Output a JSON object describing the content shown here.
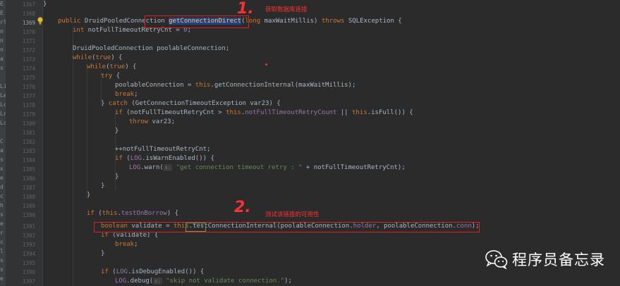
{
  "left_strip": [
    "E",
    "E",
    "rl",
    "n",
    "n",
    "n",
    "a",
    "s",
    "",
    "Li",
    "Le",
    "Lc",
    "Lr",
    "Lc",
    "",
    "C",
    "a",
    "s",
    "x",
    "e",
    "d",
    "c",
    "h",
    "s",
    "e",
    "r",
    "c",
    "l",
    "s",
    "s",
    "e"
  ],
  "line_numbers": [
    "1367",
    "1368",
    "1369",
    "1370",
    "1371",
    "1372",
    "1373",
    "1374",
    "1375",
    "1376",
    "1377",
    "1378",
    "1379",
    "1380",
    "1381",
    "1382",
    "1383",
    "1384",
    "1385",
    "1386",
    "1387",
    "1388",
    "1389",
    "1390",
    "1391",
    "1392",
    "1393",
    "1394",
    "1395",
    "1396",
    "1397"
  ],
  "code": {
    "l1367": "}",
    "l1369_kw1": "public",
    "l1369_type": " DruidPooledConnection ",
    "l1369_fn": "getConnectionDirect",
    "l1369_p1": "(",
    "l1369_kw2": "long",
    "l1369_p2": " maxWaitMillis) ",
    "l1369_kw3": "throws",
    "l1369_p3": " SQLException {",
    "l1370_kw": "int",
    "l1370_rest": " notFullTimeoutRetryCnt = ",
    "l1370_num": "0",
    "l1370_end": ";",
    "l1372": "DruidPooledConnection poolableConnection;",
    "l1373_kw": "while",
    "l1373_p": "(",
    "l1373_kw2": "true",
    "l1373_end": ") {",
    "l1374_kw": "while",
    "l1374_p": "(",
    "l1374_kw2": "true",
    "l1374_end": ") {",
    "l1375_kw": "try",
    "l1375_end": " {",
    "l1376_a": "poolableConnection = ",
    "l1376_kw": "this",
    "l1376_b": ".getConnectionInternal(maxWaitMillis);",
    "l1377_kw": "break",
    "l1377_end": ";",
    "l1378_a": "} ",
    "l1378_kw": "catch",
    "l1378_b": " (GetConnectionTimeoutException var23) {",
    "l1379_kw": "if",
    "l1379_a": " (notFullTimeoutRetryCnt > ",
    "l1379_kw2": "this",
    "l1379_b": ".",
    "l1379_mb": "notFullTimeoutRetryCount",
    "l1379_c": " || ",
    "l1379_kw3": "this",
    "l1379_d": ".isFull()) {",
    "l1380_kw": "throw",
    "l1380_rest": " var23;",
    "l1381": "}",
    "l1383": "++notFullTimeoutRetryCnt;",
    "l1384_kw": "if",
    "l1384_a": " (",
    "l1384_mb": "LOG",
    "l1384_b": ".isWarnEnabled()) {",
    "l1385_mb": "LOG",
    "l1385_a": ".warn(",
    "l1385_hint": "s:",
    "l1385_st": "\"get connection timeout retry : \"",
    "l1385_b": " + notFullTimeoutRetryCnt);",
    "l1386": "}",
    "l1387": "}",
    "l1388": "}",
    "l1390_kw": "if",
    "l1390_a": " (",
    "l1390_kw2": "this",
    "l1390_b": ".",
    "l1390_mb": "testOnBorrow",
    "l1390_c": ") {",
    "l1391_kw": "boolean",
    "l1391_a": " validate = ",
    "l1391_kw2": "this",
    "l1391_b": ".",
    "l1391_hl": "test",
    "l1391_c": "ConnectionInternal(poolableConnection.",
    "l1391_mb": "holder",
    "l1391_d": ", poolableConnection.",
    "l1391_mb2": "conn",
    "l1391_e": ");",
    "l1392_kw": "if",
    "l1392_rest": " (validate) {",
    "l1393_kw": "break",
    "l1393_end": ";",
    "l1394": "}",
    "l1396_kw": "if",
    "l1396_a": " (",
    "l1396_mb": "LOG",
    "l1396_b": ".isDebugEnabled()) {",
    "l1397_mb": "LOG",
    "l1397_a": ".debug(",
    "l1397_hint": "s:",
    "l1397_st": "\"skip not validate connection.\"",
    "l1397_b": ");"
  },
  "annotations": {
    "num1": "1.",
    "label1": "获取数据库连接",
    "num2": "2.",
    "label2": "测试该链接的可用性"
  },
  "watermark": {
    "text": "程序员备忘录",
    "icon": "wechat-icon"
  },
  "colors": {
    "annotation_red": "#ff3030",
    "keyword": "#cc7832",
    "method_decl": "#ffc66d",
    "field": "#9876aa",
    "string": "#6a8759",
    "number": "#6897bb",
    "text": "#a9b7c6"
  }
}
